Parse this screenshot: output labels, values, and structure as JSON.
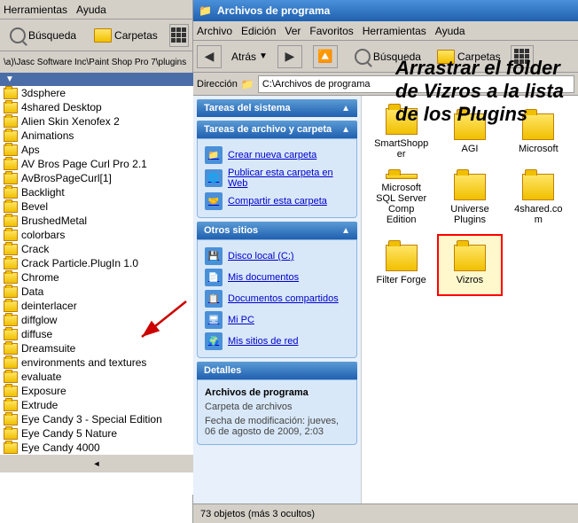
{
  "leftPanel": {
    "menubar": [
      "Herramientas",
      "Ayuda"
    ],
    "toolbar": {
      "search": "Búsqueda",
      "folders": "Carpetas"
    },
    "addressBar": "\\a)\\Jasc Software Inc\\Paint Shop Pro 7\\plugins",
    "files": [
      "3dsphere",
      "4shared Desktop",
      "Alien Skin Xenofex 2",
      "Animations",
      "Aps",
      "AV Bros Page Curl Pro 2.1",
      "AvBrosPageCurl[1]",
      "Backlight",
      "Bevel",
      "BrushedMetal",
      "colorbars",
      "Crack",
      "Crack Particle.PlugIn 1.0",
      "Chrome",
      "Data",
      "deinterlacer",
      "diffglow",
      "diffuse",
      "Dreamsuite",
      "environments and textures",
      "evaluate",
      "Exposure",
      "Extrude",
      "Eye Candy 3 - Special Edition",
      "Eye Candy 5 Nature",
      "Eye Candy 4000"
    ]
  },
  "rightPanel": {
    "titlebar": "Archivos de programa",
    "menubar": [
      "Archivo",
      "Edición",
      "Ver",
      "Favoritos",
      "Herramientas",
      "Ayuda"
    ],
    "address": "C:\\Archivos de programa",
    "instruction": "Arrastrar el folder de Vizros a la lista de los Plugins",
    "tasksSection": {
      "title": "Tareas del sistema",
      "fileTasksTitle": "Tareas de archivo y carpeta",
      "links": [
        "Crear nueva carpeta",
        "Publicar esta carpeta en Web",
        "Compartir esta carpeta"
      ],
      "otrosSitiosTitle": "Otros sitios",
      "sitios": [
        "Disco local (C:)",
        "Mis documentos",
        "Documentos compartidos",
        "Mi PC",
        "Mis sitios de red"
      ],
      "detallesTitle": "Detalles",
      "detallesContent": {
        "name": "Archivos de programa",
        "type": "Carpeta de archivos",
        "modified": "Fecha de modificación: jueves, 06 de agosto de 2009, 2:03"
      }
    },
    "folders": [
      "SmartShopper",
      "AGI",
      "Microsoft",
      "Microsoft SQL Server Comp Edition",
      "Universe Plugins",
      "4shared.com",
      "Filter Forge",
      "Vizros"
    ],
    "statusBar": "73 objetos (más 3 ocultos)"
  }
}
